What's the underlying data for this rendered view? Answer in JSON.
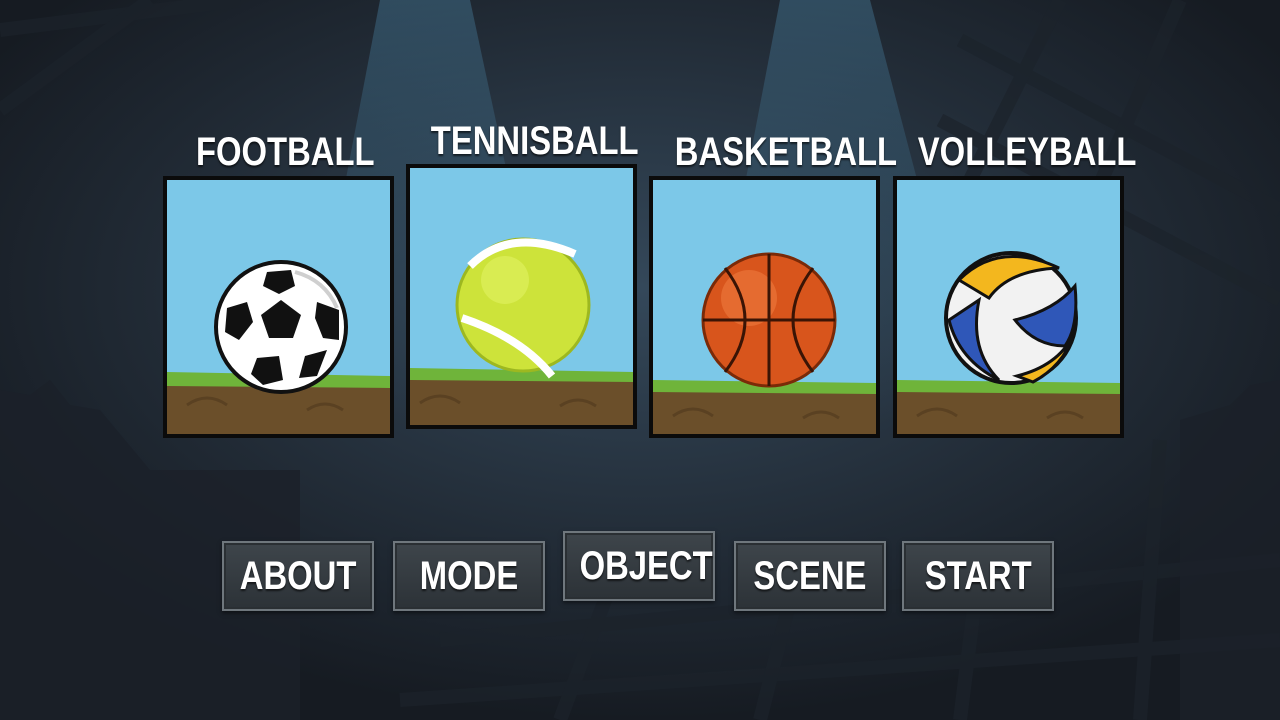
{
  "theme": {
    "sky": "#7cc8e8",
    "grass": "#6fb43a",
    "dirt": "#6b4f2a",
    "button_bg": "#353b40",
    "button_border": "#6f777d"
  },
  "balls": [
    {
      "title": "FOOTBALL",
      "icon": "soccer-ball-icon"
    },
    {
      "title": "TENNISBALL",
      "icon": "tennis-ball-icon"
    },
    {
      "title": "BASKETBALL",
      "icon": "basketball-icon"
    },
    {
      "title": "VOLLEYBALL",
      "icon": "volleyball-icon"
    }
  ],
  "menu": {
    "about": "ABOUT",
    "mode": "MODE",
    "object": "OBJECT",
    "scene": "SCENE",
    "start": "START"
  }
}
